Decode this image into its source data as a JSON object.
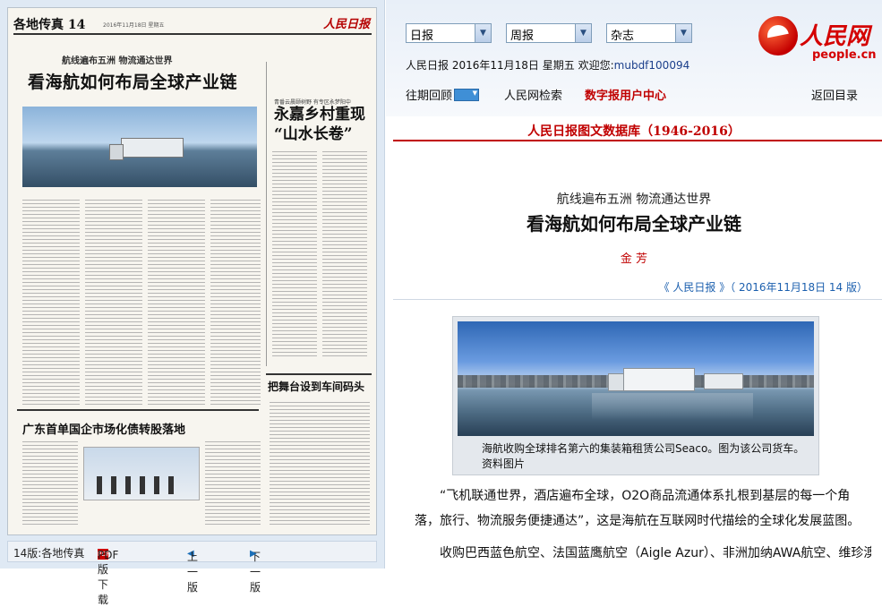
{
  "left_page": {
    "header": {
      "page_name": "各地传真 14",
      "date": "2016年11月18日 星期五",
      "logo": "人民日报"
    },
    "headline_sub": "航线遍布五洲 物流通达世界",
    "headline": "看海航如何布局全球产业链",
    "side_story_sub": "青番云晨颐树野 有专区永梦阳中",
    "side_story_title_1": "永嘉乡村重现",
    "side_story_title_2": "“山水长卷”",
    "bottom_right_title": "把舞台设到车间码头",
    "bottom_left_title": "广东首单国企市场化债转股落地",
    "bottom_nav": {
      "page_label": "14版:各地传真",
      "pdf_icon": "pdf-icon",
      "pdf_label": "PDF版下载",
      "prev_label": "上一版",
      "next_label": "下一版"
    }
  },
  "top": {
    "selects": [
      {
        "value": "日报"
      },
      {
        "value": "周报"
      },
      {
        "value": "杂志"
      }
    ],
    "info": {
      "paper": "人民日报",
      "date": "2016年11月18日",
      "weekday": "星期五",
      "welcome": "欢迎您:",
      "user": "mubdf100094"
    },
    "logo": {
      "cn": "人民网",
      "en": "people.cn"
    },
    "nav": {
      "archive": "往期回顾",
      "search": "人民网检索",
      "digital_center": "数字报用户中心",
      "back": "返回目录"
    }
  },
  "article": {
    "database_title": "人民日报图文数据库（1946-2016）",
    "subtitle": "航线遍布五洲 物流通达世界",
    "title": "看海航如何布局全球产业链",
    "author": "金 芳",
    "source": "《 人民日报 》（ 2016年11月18日   14 版）",
    "photo_caption": "海航收购全球排名第六的集装箱租赁公司Seaco。图为该公司货车。资料图片",
    "paragraphs": [
      "“飞机联通世界，酒店遍布全球，O2O商品流通体系扎根到基层的每一个角落，旅行、物流服务便捷通达”，这是海航在互联网时代描绘的全球化发展蓝图。",
      "收购巴西蓝色航空、法国蓝鹰航空（Aigle Azur）、非洲加纳AWA航空、维珍澳"
    ]
  },
  "colors": {
    "accent_red": "#c00000",
    "link_blue": "#1b5fae",
    "pane_blue": "#dfe9f4"
  }
}
